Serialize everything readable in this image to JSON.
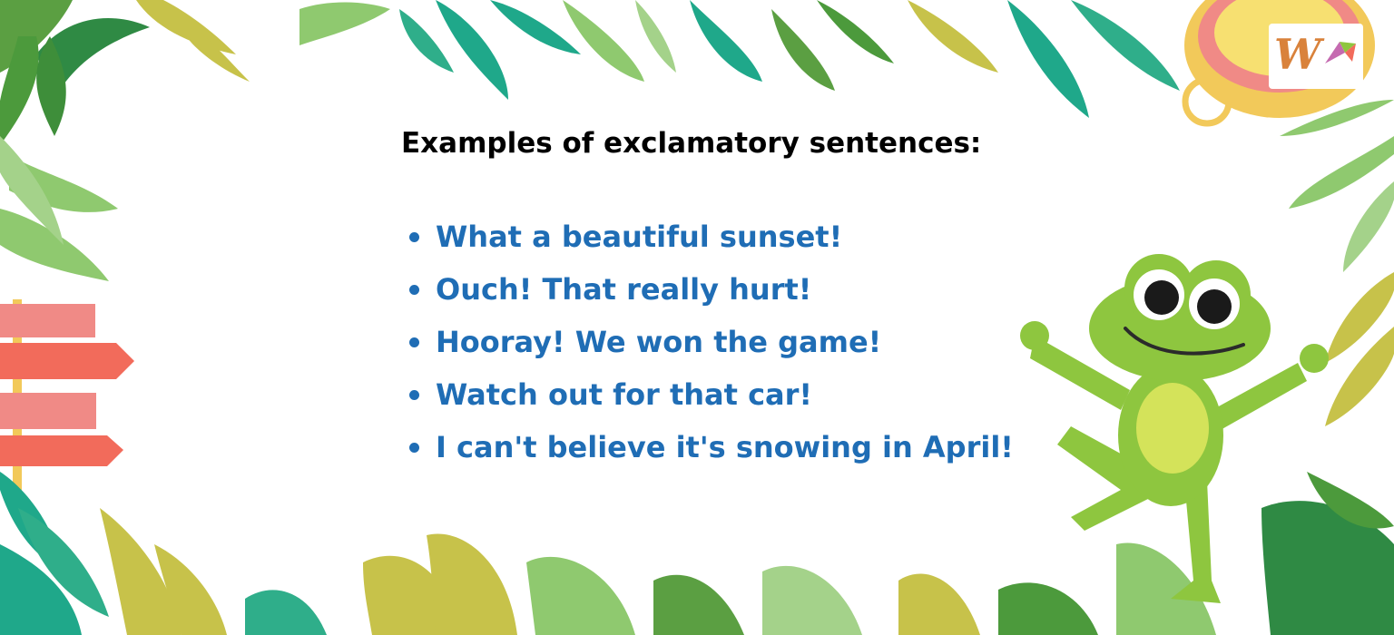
{
  "heading": "Examples of exclamatory sentences:",
  "examples": [
    "What a beautiful sunset!",
    "Ouch! That really hurt!",
    "Hooray! We won the game!",
    "Watch out for that car!",
    "I can't believe it's snowing in April!"
  ],
  "logo": {
    "letter": "W"
  },
  "colors": {
    "heading": "#000000",
    "example_text": "#1f6db5",
    "logo_letter": "#d9823b",
    "leaf_teal": "#1fa88a",
    "leaf_green": "#5b9f42",
    "leaf_light": "#8fc96f",
    "leaf_olive": "#c7c24a",
    "frog": "#8ec63f",
    "frog_belly": "#d4e35a",
    "sign_pink": "#f08a86",
    "sign_coral": "#f26b5b"
  },
  "icons": [
    "signpost-icon",
    "frog-icon",
    "compass-icon",
    "leaf-icon",
    "logo-icon"
  ]
}
